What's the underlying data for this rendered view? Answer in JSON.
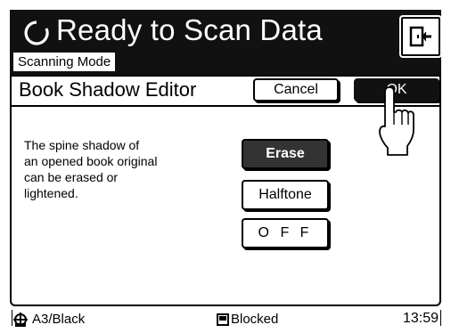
{
  "header": {
    "title": "Ready to Scan Data",
    "mode": "Scanning Mode",
    "icon": "refresh-icon",
    "exit_icon": "exit-door-icon"
  },
  "panel": {
    "title": "Book Shadow Editor",
    "cancel_label": "Cancel",
    "ok_label": "OK",
    "description": "The spine shadow of\nan opened book original\ncan be erased or\nlightened.",
    "options": [
      "Erase",
      "Halftone",
      "O F F"
    ],
    "selected": "Erase"
  },
  "status": {
    "paper": "A3/Black",
    "state": "Blocked",
    "time": "13:59"
  }
}
